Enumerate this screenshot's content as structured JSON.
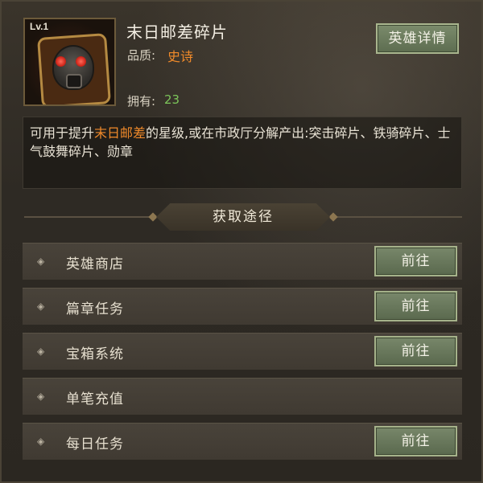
{
  "hero": {
    "level": "Lv.1",
    "name": "末日邮差碎片",
    "quality_label": "品质:",
    "quality_value": "史诗",
    "owned_label": "拥有:",
    "owned_value": "23",
    "detail_button": "英雄详情"
  },
  "description": {
    "before": "可用于提升",
    "highlight": "末日邮差",
    "after": "的星级,或在市政厅分解产出:突击碎片、铁骑碎片、士气鼓舞碎片、勋章"
  },
  "section_title": "获取途径",
  "routes": [
    {
      "label": "英雄商店",
      "button": "前往"
    },
    {
      "label": "篇章任务",
      "button": "前往"
    },
    {
      "label": "宝箱系统",
      "button": "前往"
    },
    {
      "label": "单笔充值",
      "button": ""
    },
    {
      "label": "每日任务",
      "button": "前往"
    }
  ],
  "icons": {
    "hero_portrait": "gas-mask-puzzle-icon",
    "route_bullet": "diamond-bullet-icon"
  },
  "colors": {
    "epic": "#f08a2a",
    "owned_count": "#7cc55a",
    "button_green": "#6a7a5d"
  }
}
